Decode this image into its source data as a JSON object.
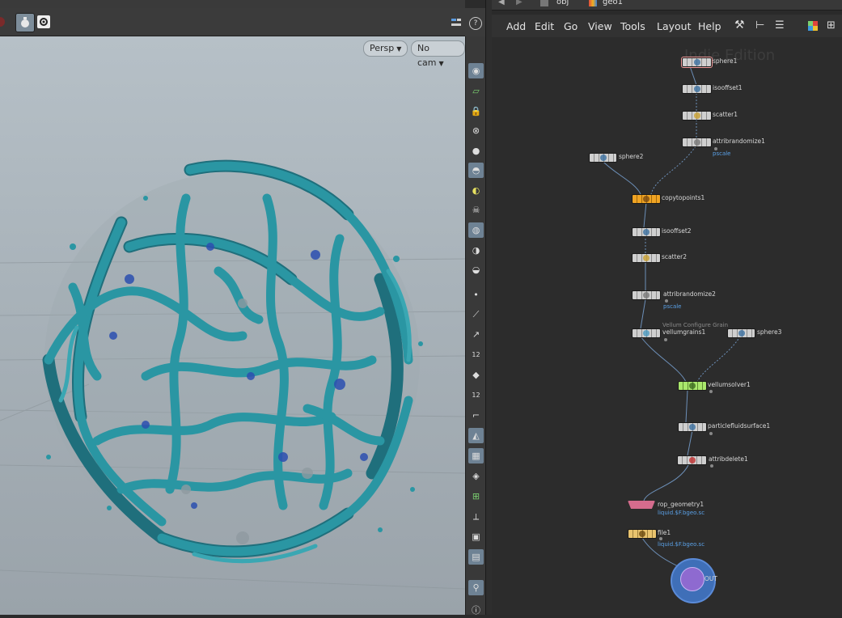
{
  "viewport": {
    "persp_label": "Persp",
    "cam_label": "No cam",
    "color_blob": "#2a96a3",
    "color_blob_dark": "#1f6f7c",
    "color_blue_spots": "#2c4fb0"
  },
  "path_bar": {
    "network": "obj",
    "node": "geo1"
  },
  "menu": {
    "add": "Add",
    "edit": "Edit",
    "go": "Go",
    "view": "View",
    "tools": "Tools",
    "layout": "Layout",
    "help": "Help"
  },
  "watermark": "Indie Edition",
  "shelf_labels": {
    "a": "12",
    "b": "12"
  },
  "nodes": {
    "sphere1": "sphere1",
    "isooffset1": "isooffset1",
    "scatter1": "scatter1",
    "attribrandomize1": "attribrandomize1",
    "attribrandomize1_sub": "pscale",
    "sphere2": "sphere2",
    "copytopoints1": "copytopoints1",
    "isooffset2": "isooffset2",
    "scatter2": "scatter2",
    "attribrandomize2": "attribrandomize2",
    "attribrandomize2_sub": "pscale",
    "vellumgrains_comment": "Vellum Configure Grain",
    "vellumgrains1": "vellumgrains1",
    "sphere3": "sphere3",
    "vellumsolver1": "vellumsolver1",
    "particlefluidsurface1": "particlefluidsurface1",
    "attribdelete1": "attribdelete1",
    "rop_geometry1": "rop_geometry1",
    "rop_geometry1_sub": "liquid.$F.bgeo.sc",
    "file1": "file1",
    "file1_sub": "liquid.$F.bgeo.sc",
    "out": "OUT"
  }
}
